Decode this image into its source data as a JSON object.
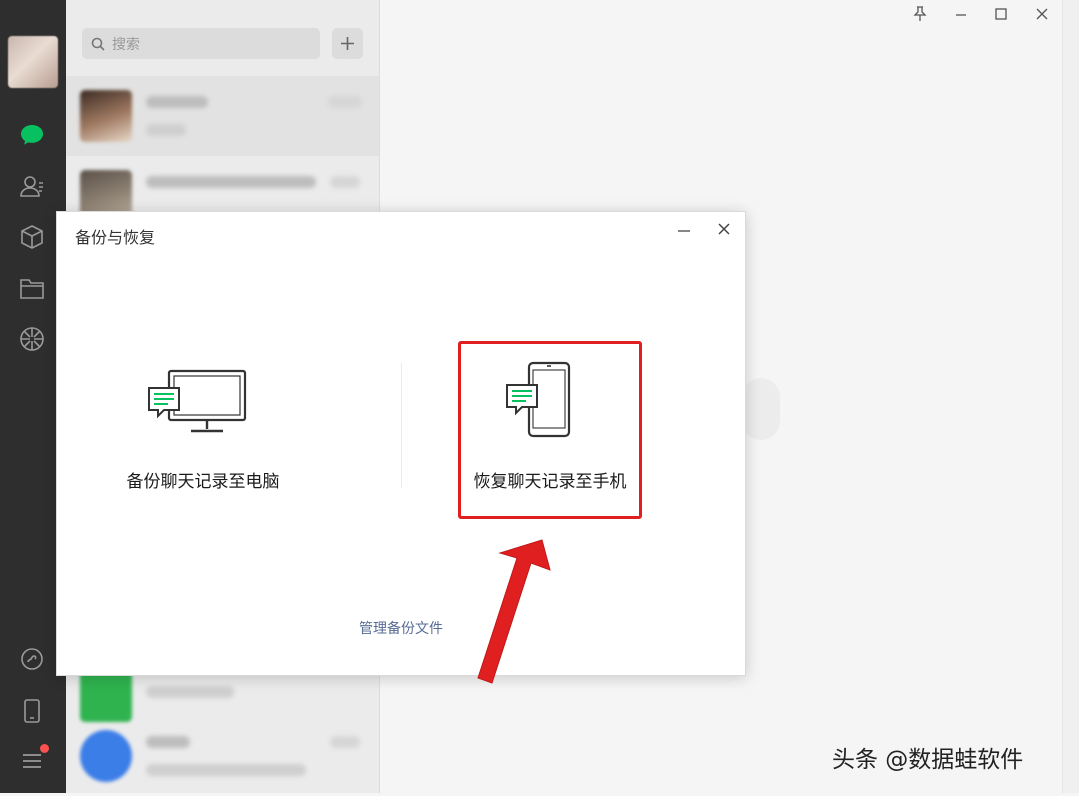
{
  "search": {
    "placeholder": "搜索"
  },
  "dialog": {
    "title": "备份与恢复",
    "option_backup_label": "备份聊天记录至电脑",
    "option_restore_label": "恢复聊天记录至手机",
    "manage_link": "管理备份文件"
  },
  "watermark": "头条 @数据蛙软件",
  "colors": {
    "nav_bg": "#2e2e2e",
    "accent_green": "#07c160",
    "highlight_red": "#e02020",
    "link_blue": "#576b95"
  },
  "nav_icons": [
    "chat-icon",
    "contacts-icon",
    "favorites-icon",
    "files-icon",
    "moments-icon",
    "miniprogram-icon",
    "phone-icon",
    "menu-icon"
  ]
}
